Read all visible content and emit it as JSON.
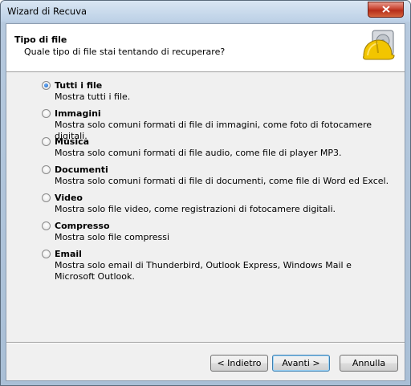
{
  "window": {
    "title": "Wizard di Recuva"
  },
  "header": {
    "title": "Tipo di file",
    "subtitle": "Quale tipo di file stai tentando di recuperare?"
  },
  "options": [
    {
      "label": "Tutti i file",
      "desc": "Mostra tutti i file.",
      "selected": true
    },
    {
      "label": "Immagini",
      "desc": "Mostra solo comuni formati di file di immagini, come foto di fotocamere digitali.",
      "selected": false
    },
    {
      "label": "Musica",
      "desc": "Mostra solo comuni formati di file audio, come file di player MP3.",
      "selected": false
    },
    {
      "label": "Documenti",
      "desc": "Mostra solo comuni formati di file di documenti, come file di Word ed Excel.",
      "selected": false
    },
    {
      "label": "Video",
      "desc": "Mostra solo file video, come registrazioni di fotocamere digitali.",
      "selected": false
    },
    {
      "label": "Compresso",
      "desc": "Mostra solo file compressi",
      "selected": false
    },
    {
      "label": "Email",
      "desc": "Mostra solo email di Thunderbird, Outlook Express, Windows Mail e Microsoft Outlook.",
      "selected": false
    }
  ],
  "buttons": {
    "back": "< Indietro",
    "next": "Avanti >",
    "cancel": "Annulla"
  },
  "icons": {
    "close": "close-icon",
    "header": "recuva-hardhat-icon"
  }
}
